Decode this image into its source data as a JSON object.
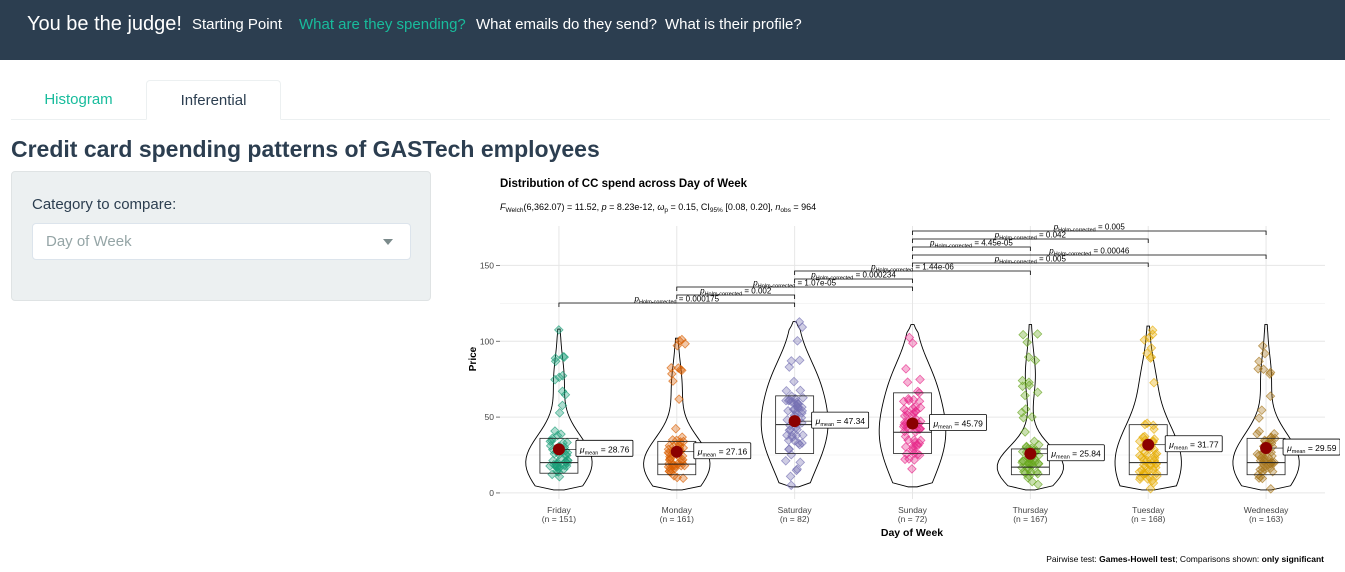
{
  "navbar": {
    "brand": "You be the judge!",
    "links": [
      "Starting Point",
      "What are they spending?",
      "What emails do they send?",
      "What is their profile?"
    ],
    "active": "What are they spending?",
    "bg": "#2c3e50",
    "active_color": "#18bc9c"
  },
  "tabs": [
    "Histogram",
    "Inferential"
  ],
  "active_tab": "Inferential",
  "page_title": "Credit card spending patterns of GASTech employees",
  "sidebar": {
    "label": "Category to compare:",
    "select_value": "Day of Week"
  },
  "chart_data": {
    "type": "violin-box-scatter",
    "title": "Distribution of CC spend across Day of Week",
    "subtitle": {
      "statistic": "F",
      "statistic_sub": "Welch",
      "statistic_text": "(6,362.07) = 11.52, ",
      "p_text": " = 8.23e-12, ",
      "effsize_text": " = 0.15, CI",
      "ci_sub": "95%",
      "ci_text": " [0.08, 0.20], ",
      "n_label": "n",
      "n_sub": "obs",
      "n_text": " = 964"
    },
    "xlabel": "Day of Week",
    "ylabel": "Price",
    "ylim": [
      -4,
      176
    ],
    "yticks": [
      0,
      50,
      100,
      150
    ],
    "grid": true,
    "categories": [
      "Friday",
      "Monday",
      "Saturday",
      "Sunday",
      "Thursday",
      "Tuesday",
      "Wednesday"
    ],
    "n_labels": [
      "(n = 151)",
      "(n = 161)",
      "(n = 82)",
      "(n = 72)",
      "(n = 167)",
      "(n = 168)",
      "(n = 163)"
    ],
    "colors": [
      "#1b9e77",
      "#d95f02",
      "#7570b3",
      "#e7298a",
      "#66a61e",
      "#e6ab02",
      "#a6761d"
    ],
    "means": [
      28.76,
      27.16,
      47.34,
      45.79,
      25.84,
      31.77,
      29.59
    ],
    "mean_label_prefix": "μ",
    "mean_label_sub": "mean",
    "box_stats": [
      {
        "q1": 13,
        "median": 20,
        "q3": 36,
        "min": 2,
        "max": 108
      },
      {
        "q1": 12,
        "median": 19,
        "q3": 34,
        "min": 2,
        "max": 102
      },
      {
        "q1": 26,
        "median": 45,
        "q3": 64,
        "min": 4,
        "max": 113
      },
      {
        "q1": 26,
        "median": 40,
        "q3": 66,
        "min": 4,
        "max": 111
      },
      {
        "q1": 12,
        "median": 17,
        "q3": 29,
        "min": 2,
        "max": 111
      },
      {
        "q1": 12,
        "median": 20,
        "q3": 45,
        "min": 2,
        "max": 110
      },
      {
        "q1": 12,
        "median": 20,
        "q3": 36,
        "min": 2,
        "max": 111
      }
    ],
    "pairwise_prefix": "p",
    "pairwise_sub": "Holm-corrected",
    "pairwise": [
      {
        "from": "Friday",
        "to": "Saturday",
        "value": "0.000175"
      },
      {
        "from": "Monday",
        "to": "Saturday",
        "value": "0.002"
      },
      {
        "from": "Monday",
        "to": "Sunday",
        "value": "1.07e-05"
      },
      {
        "from": "Saturday",
        "to": "Sunday",
        "value": "0.000234"
      },
      {
        "from": "Saturday",
        "to": "Thursday",
        "value": "1.44e-06"
      },
      {
        "from": "Sunday",
        "to": "Tuesday",
        "value": "0.005"
      },
      {
        "from": "Sunday",
        "to": "Wednesday",
        "value": "0.00046"
      },
      {
        "from": "Sunday",
        "to": "Thursday",
        "value": "4.45e-05"
      },
      {
        "from": "Sunday",
        "to": "Tuesday",
        "value": "0.042"
      },
      {
        "from": "Sunday",
        "to": "Wednesday",
        "value": "0.005"
      }
    ],
    "caption": {
      "prefix": "Pairwise test: ",
      "test": "Games-Howell test",
      "middle": "; Comparisons shown: ",
      "shown": "only significant"
    }
  }
}
